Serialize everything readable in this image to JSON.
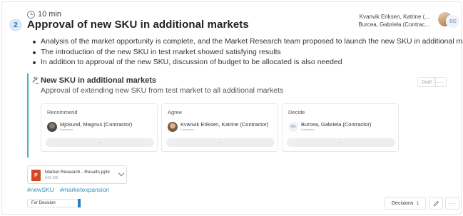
{
  "agenda_item": {
    "number": "2",
    "duration": "10 min",
    "title": "Approval of new SKU in additional markets",
    "presenters": [
      "Kvanvik Eriksen, Katrine (...",
      "Burcea, Gabriela (Contrac..."
    ],
    "presenter_initials": "BG",
    "notes": [
      "Analysis of the market opportunity is complete, and the Market Research team proposed to launch the new SKU in additional markets",
      "The introduction of the new SKU in test market showed satisfying results",
      "In addition to approval of the new SKU, discussion of budget to be allocated is also needed"
    ]
  },
  "decision": {
    "title": "New SKU in additional markets",
    "subtitle": "Approval of extending new SKU from test market to all additional markets",
    "status_badge": "Draft",
    "more_label": "···",
    "roles": [
      {
        "label": "Recommend",
        "name": "Mjosund, Magnus (Contractor)",
        "sub": "Contractor",
        "initials": "",
        "pill": "-"
      },
      {
        "label": "Agree",
        "name": "Kvanvik Eriksen, Katrine (Contractor)",
        "sub": "Contractor",
        "initials": "",
        "pill": "-"
      },
      {
        "label": "Decide",
        "name": "Burcea, Gabriela (Contractor)",
        "sub": "Contractor",
        "initials": "BG",
        "pill": "-"
      }
    ]
  },
  "attachment": {
    "name": "Market Research - Results.pptx",
    "size": "242 KB",
    "icon_letter": "P"
  },
  "tags": [
    "#newSKU",
    "#marketexpansion"
  ],
  "footer": {
    "status": "For Decision",
    "decisions_label": "Decisions",
    "decisions_count": "1",
    "more_label": "···"
  },
  "colors": {
    "accent": "#3fb3c6",
    "tag": "#3a8fb7",
    "status_bar": "#2a7fc4",
    "ppt": "#d24726"
  },
  "icons": [
    "clock-icon",
    "gavel-icon",
    "ppt-file-icon",
    "chevron-down-icon",
    "pencil-icon",
    "more-icon"
  ]
}
